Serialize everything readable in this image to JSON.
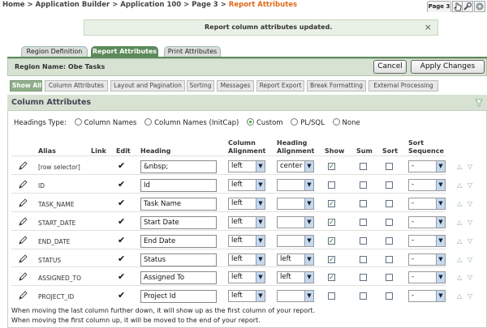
{
  "breadcrumb": {
    "items": [
      "Home",
      "Application Builder",
      "Application 100",
      "Page 3"
    ],
    "current": "Report Attributes",
    "separator": ">"
  },
  "page_tab": "Page 3",
  "message": {
    "text": "Report column attributes updated.",
    "close": "×"
  },
  "region_tabs": [
    "Region Definition",
    "Report Attributes",
    "Print Attributes"
  ],
  "region": {
    "label": "Region Name:",
    "value": "Obe Tasks"
  },
  "buttons": {
    "cancel": "Cancel",
    "apply": "Apply Changes"
  },
  "subtabs": [
    "Show All",
    "Column Attributes",
    "Layout and Pagination",
    "Sorting",
    "Messages",
    "Report Export",
    "Break Formatting",
    "External Processing"
  ],
  "panel": {
    "title": "Column Attributes"
  },
  "headings_type": {
    "label": "Headings Type:",
    "options": [
      "Column Names",
      "Column Names (InitCap)",
      "Custom",
      "PL/SQL",
      "None"
    ],
    "selected": "Custom"
  },
  "table": {
    "headers": {
      "alias": "Alias",
      "link": "Link",
      "edit": "Edit",
      "heading": "Heading",
      "col_align": [
        "Column",
        "Alignment"
      ],
      "head_align": [
        "Heading",
        "Alignment"
      ],
      "show": "Show",
      "sum": "Sum",
      "sort": "Sort",
      "sort_seq": [
        "Sort",
        "Sequence"
      ]
    },
    "rows": [
      {
        "alias": "[row selector]",
        "heading": "&nbsp;",
        "col_align": "left",
        "head_align": "center",
        "show": true,
        "sum": false,
        "sort": false,
        "seq": "-"
      },
      {
        "alias": "ID",
        "heading": "Id",
        "col_align": "left",
        "head_align": "",
        "show": false,
        "sum": false,
        "sort": false,
        "seq": "-"
      },
      {
        "alias": "TASK_NAME",
        "heading": "Task Name",
        "col_align": "left",
        "head_align": "",
        "show": true,
        "sum": false,
        "sort": false,
        "seq": "-"
      },
      {
        "alias": "START_DATE",
        "heading": "Start Date",
        "col_align": "left",
        "head_align": "",
        "show": true,
        "sum": false,
        "sort": false,
        "seq": "-"
      },
      {
        "alias": "END_DATE",
        "heading": "End Date",
        "col_align": "left",
        "head_align": "",
        "show": true,
        "sum": false,
        "sort": false,
        "seq": "-"
      },
      {
        "alias": "STATUS",
        "heading": "Status",
        "col_align": "left",
        "head_align": "left",
        "show": true,
        "sum": false,
        "sort": false,
        "seq": "-"
      },
      {
        "alias": "ASSIGNED_TO",
        "heading": "Assigned To",
        "col_align": "left",
        "head_align": "left",
        "show": true,
        "sum": false,
        "sort": false,
        "seq": "-"
      },
      {
        "alias": "PROJECT_ID",
        "heading": "Project Id",
        "col_align": "left",
        "head_align": "",
        "show": false,
        "sum": false,
        "sort": false,
        "seq": "-"
      }
    ]
  },
  "notes": [
    "When moving the last column further down, it will show up as the first column of your report.",
    "When moving the first column up, it will be moved to the end of your report."
  ]
}
